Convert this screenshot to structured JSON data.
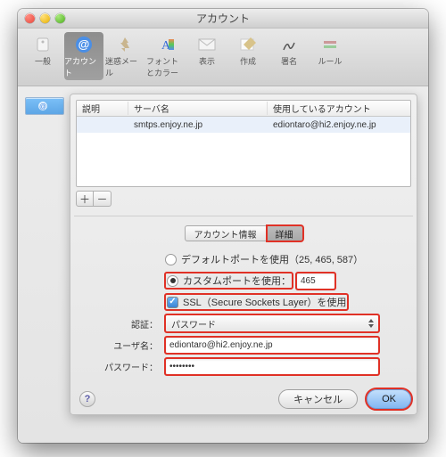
{
  "window": {
    "title": "アカウント"
  },
  "toolbar": {
    "items": [
      {
        "label": "一般"
      },
      {
        "label": "アカウント"
      },
      {
        "label": "迷惑メール"
      },
      {
        "label": "フォントとカラー"
      },
      {
        "label": "表示"
      },
      {
        "label": "作成"
      },
      {
        "label": "署名"
      },
      {
        "label": "ルール"
      }
    ]
  },
  "table": {
    "headers": {
      "desc": "説明",
      "server": "サーバ名",
      "account": "使用しているアカウント"
    },
    "row": {
      "desc": "",
      "server": "smtps.enjoy.ne.jp",
      "account": "ediontaro@hi2.enjoy.ne.jp"
    }
  },
  "plus": "＋",
  "minus": "－",
  "tabs": {
    "info": "アカウント情報",
    "detail": "詳細"
  },
  "ports": {
    "default_label": "デフォルトポートを使用（25, 465, 587）",
    "custom_label": "カスタムポートを使用：",
    "custom_value": "465",
    "ssl_label": "SSL（Secure Sockets Layer）を使用"
  },
  "auth_label": "認証：",
  "auth_value": "パスワード",
  "user_label": "ユーザ名：",
  "user_value": "ediontaro@hi2.enjoy.ne.jp",
  "pass_label": "パスワード：",
  "pass_value": "••••••••",
  "help": "?",
  "buttons": {
    "cancel": "キャンセル",
    "ok": "OK"
  }
}
